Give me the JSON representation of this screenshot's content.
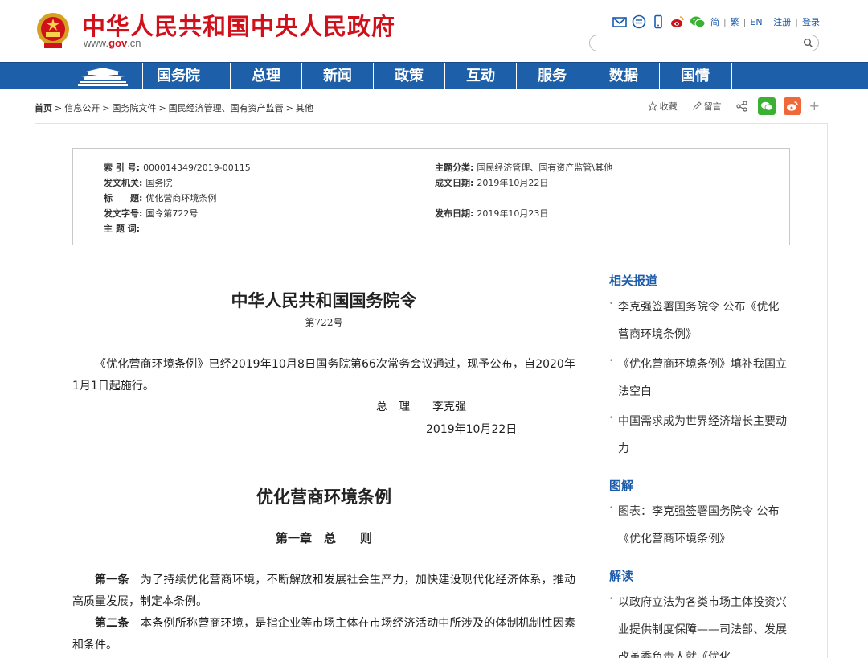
{
  "header": {
    "site_title": "中华人民共和国中央人民政府",
    "site_url_prefix": "www.",
    "site_url_brand": "gov",
    "site_url_suffix": ".cn",
    "links": [
      "简",
      "繁",
      "EN",
      "注册",
      "登录"
    ],
    "tool_icons": [
      "mail-icon",
      "message-icon",
      "mobile-icon",
      "weibo-icon",
      "wechat-icon"
    ],
    "search_placeholder": ""
  },
  "nav": {
    "items": [
      "国务院",
      "总理",
      "新闻",
      "政策",
      "互动",
      "服务",
      "数据",
      "国情"
    ]
  },
  "breadcrumb": {
    "items": [
      "首页",
      "信息公开",
      "国务院文件",
      "国民经济管理、国有资产监管",
      "其他"
    ]
  },
  "share": {
    "collect": "收藏",
    "comment": "留言"
  },
  "info": {
    "index_no_label": "索 引 号:",
    "index_no": "000014349/2019-00115",
    "topic_label": "主题分类:",
    "topic": "国民经济管理、国有资产监管\\其他",
    "issuer_label": "发文机关:",
    "issuer": "国务院",
    "created_label": "成文日期:",
    "created": "2019年10月22日",
    "title_label": "标　　题:",
    "title": "优化营商环境条例",
    "doc_no_label": "发文字号:",
    "doc_no": "国令第722号",
    "published_label": "发布日期:",
    "published": "2019年10月23日",
    "keywords_label": "主 题 词:",
    "keywords": ""
  },
  "article": {
    "title": "中华人民共和国国务院令",
    "order_no": "第722号",
    "intro": "《优化营商环境条例》已经2019年10月8日国务院第66次常务会议通过，现予公布，自2020年1月1日起施行。",
    "signer": "总　理　　李克强",
    "sign_date": "2019年10月22日",
    "regulation_title": "优化营商环境条例",
    "chapter": "第一章　总　　则",
    "article1_label": "第一条",
    "article1": "　为了持续优化营商环境，不断解放和发展社会生产力，加快建设现代化经济体系，推动高质量发展，制定本条例。",
    "article2_label": "第二条",
    "article2": "　本条例所称营商环境，是指企业等市场主体在市场经济活动中所涉及的体制机制性因素和条件。"
  },
  "sidebar": {
    "related_title": "相关报道",
    "related": [
      "李克强签署国务院令 公布《优化营商环境条例》",
      "《优化营商环境条例》填补我国立法空白",
      "中国需求成为世界经济增长主要动力"
    ],
    "graphic_title": "图解",
    "graphic": [
      "图表：李克强签署国务院令 公布《优化营商环境条例》"
    ],
    "interpret_title": "解读",
    "interpret": [
      "以政府立法为各类市场主体投资兴业提供制度保障——司法部、发展改革委负责人就《优化"
    ]
  },
  "colors": {
    "brand_red": "#d0101a",
    "nav_blue": "#1d5fa8",
    "link_blue": "#1c5ba9",
    "wechat_green": "#3cb034",
    "weibo_orange": "#f0683a"
  }
}
